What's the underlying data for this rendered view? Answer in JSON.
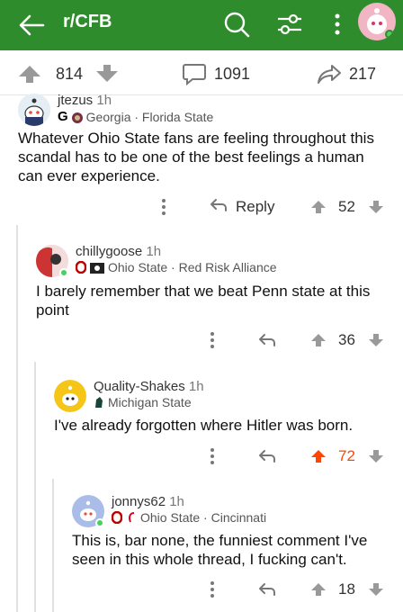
{
  "header": {
    "title": "r/CFB",
    "accent": "#2f8c2c"
  },
  "post_bar": {
    "upvotes": "814",
    "comments": "1091",
    "shares": "217"
  },
  "comments": [
    {
      "username": "jtezus",
      "age": "1h",
      "flair": "Georgia · Florida State",
      "body": "Whatever Ohio State fans are feeling throughout this scandal has to be one of the best feelings a human can ever experience.",
      "reply_label": "Reply",
      "score": "52"
    },
    {
      "username": "chillygoose",
      "age": "1h",
      "flair": "Ohio State · Red Risk Alliance",
      "body": "I barely remember that we beat Penn state at this point",
      "score": "36"
    },
    {
      "username": "Quality-Shakes",
      "age": "1h",
      "flair": "Michigan State",
      "body": "I've already forgotten where Hitler was born.",
      "score": "72",
      "score_color": "#ff4500"
    },
    {
      "username": "jonnys62",
      "age": "1h",
      "flair": "Ohio State · Cincinnati",
      "body": "This is, bar none, the funniest comment I've seen in this whole thread, I fucking can't.",
      "score": "18"
    }
  ]
}
